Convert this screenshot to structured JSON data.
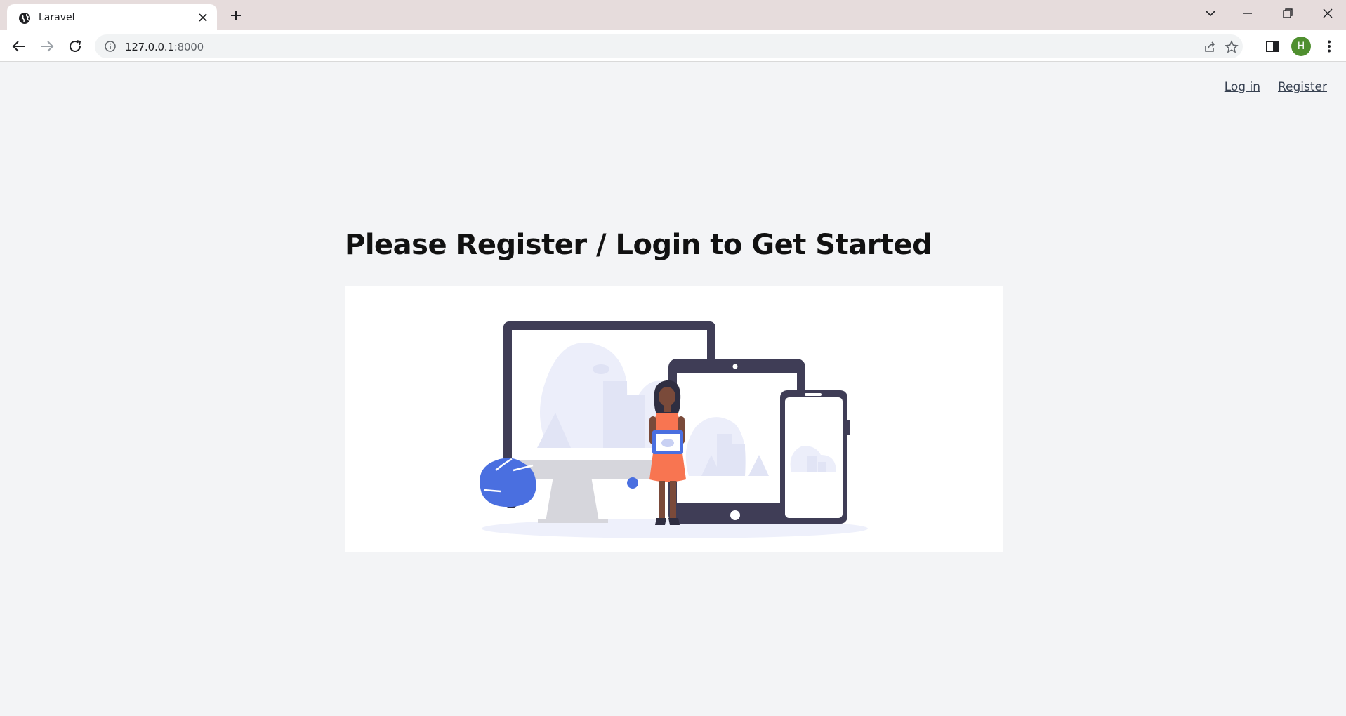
{
  "browser": {
    "tab_title": "Laravel",
    "url_host": "127.0.0.1",
    "url_port": ":8000",
    "profile_initial": "H"
  },
  "header": {
    "login_label": "Log in",
    "register_label": "Register"
  },
  "main": {
    "headline": "Please Register / Login to Get Started",
    "illustration": "devices-illustration"
  },
  "colors": {
    "page_bg": "#f3f4f6",
    "card_bg": "#ffffff",
    "device_frame": "#3f3d56",
    "accent_blue": "#4a6fe0",
    "dress": "#f87551"
  }
}
